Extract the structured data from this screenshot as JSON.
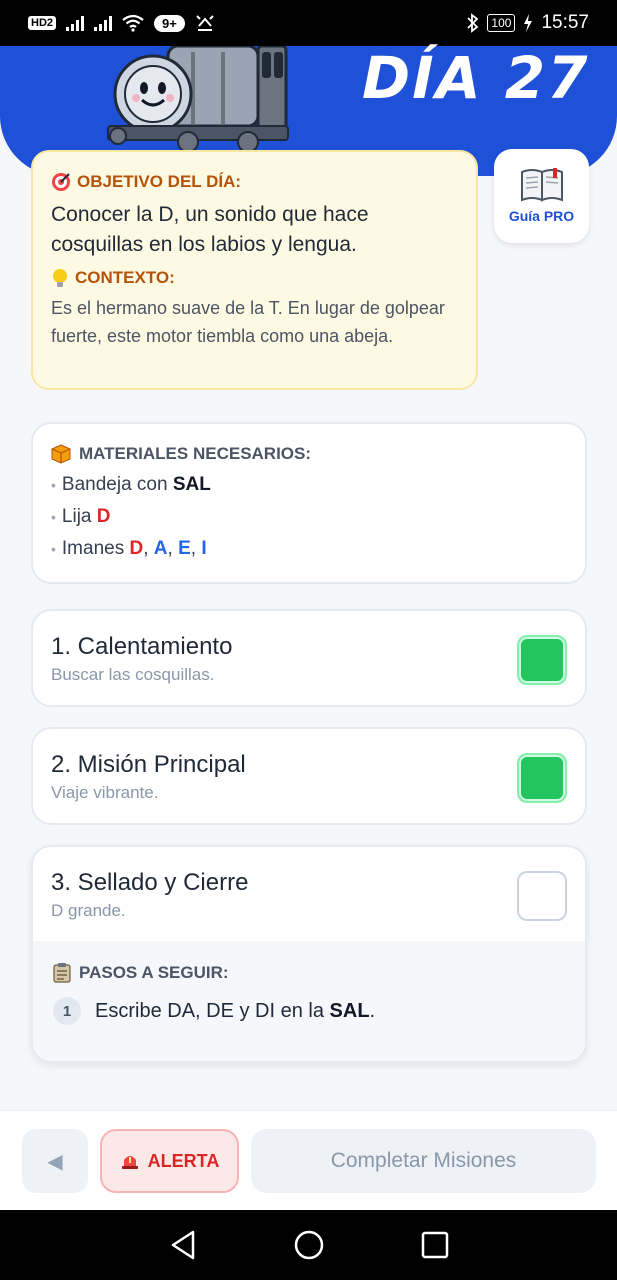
{
  "status_bar": {
    "hd": "HD",
    "sim": "2",
    "notifications": "9+",
    "battery": "100",
    "time": "15:57"
  },
  "header": {
    "day_title": "DÍA 27"
  },
  "objective": {
    "title": "OBJETIVO DEL DÍA:",
    "text": "Conocer la D, un sonido que hace cosquillas en los labios y lengua.",
    "context_title": "CONTEXTO:",
    "context_text": "Es el hermano suave de la T. En lugar de golpear fuerte, este motor tiembla como una abeja."
  },
  "guide": {
    "label": "Guía PRO"
  },
  "materials": {
    "title": "MATERIALES NECESARIOS:",
    "item1_prefix": "Bandeja con ",
    "item1_bold": "SAL",
    "item2_prefix": "Lija ",
    "item2_letter": "D",
    "item3_prefix": "Imanes ",
    "item3_l1": "D",
    "item3_l2": "A",
    "item3_l3": "E",
    "item3_l4": "I",
    "sep": ", "
  },
  "missions": [
    {
      "title": "1. Calentamiento",
      "subtitle": "Buscar las cosquillas.",
      "done": true
    },
    {
      "title": "2. Misión Principal",
      "subtitle": "Viaje vibrante.",
      "done": true
    },
    {
      "title": "3. Sellado y Cierre",
      "subtitle": "D grande.",
      "done": false
    }
  ],
  "steps": {
    "title": "PASOS A SEGUIR:",
    "step1_num": "1",
    "step1_prefix": "Escribe DA, DE y DI en la ",
    "step1_bold": "SAL",
    "step1_suffix": "."
  },
  "bottom": {
    "back": "◀",
    "alert": "ALERTA",
    "complete": "Completar Misiones"
  },
  "colors": {
    "header_blue": "#1e50d8",
    "done_green": "#22c55e",
    "alert_red": "#dc2626",
    "letter_blue": "#2563eb"
  }
}
